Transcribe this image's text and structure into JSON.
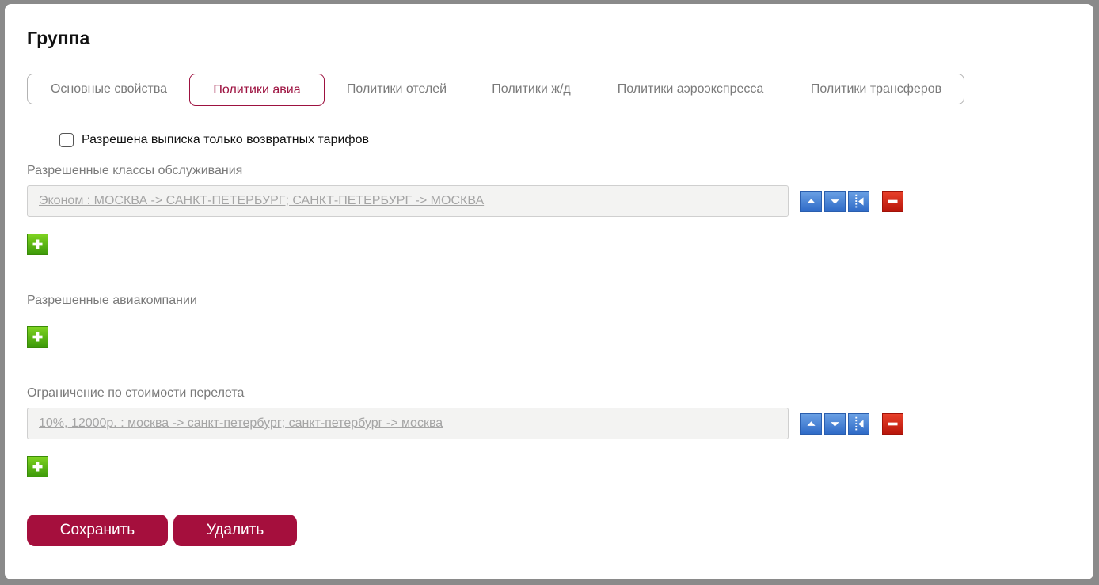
{
  "title": "Группа",
  "tabs": [
    {
      "label": "Основные свойства"
    },
    {
      "label": "Политики авиа"
    },
    {
      "label": "Политики отелей"
    },
    {
      "label": "Политики ж/д"
    },
    {
      "label": "Политики аэроэкспресса"
    },
    {
      "label": "Политики трансферов"
    }
  ],
  "active_tab": "Политики авиа",
  "refundable_only": {
    "label": "Разрешена выписка только возвратных тарифов",
    "checked": false
  },
  "service_classes": {
    "label": "Разрешенные классы обслуживания",
    "items": [
      {
        "value": "Эконом : МОСКВА -> САНКТ-ПЕТЕРБУРГ; САНКТ-ПЕТЕРБУРГ -> МОСКВА"
      }
    ]
  },
  "airlines": {
    "label": "Разрешенные авиакомпании",
    "items": []
  },
  "price_limit": {
    "label": "Ограничение по стоимости перелета",
    "items": [
      {
        "value": "10%, 12000р. : москва -> санкт-петербург; санкт-петербург -> москва"
      }
    ]
  },
  "buttons": {
    "save": "Сохранить",
    "delete": "Удалить"
  },
  "colors": {
    "accent": "#a50f3d",
    "move_buttons": "#3b78d0",
    "remove_button": "#d02814",
    "add_button": "#5cb514"
  },
  "icons": {
    "move_up": "arrow-up-icon",
    "move_down": "arrow-down-icon",
    "insert": "insert-icon",
    "remove": "minus-icon",
    "add": "plus-icon"
  }
}
